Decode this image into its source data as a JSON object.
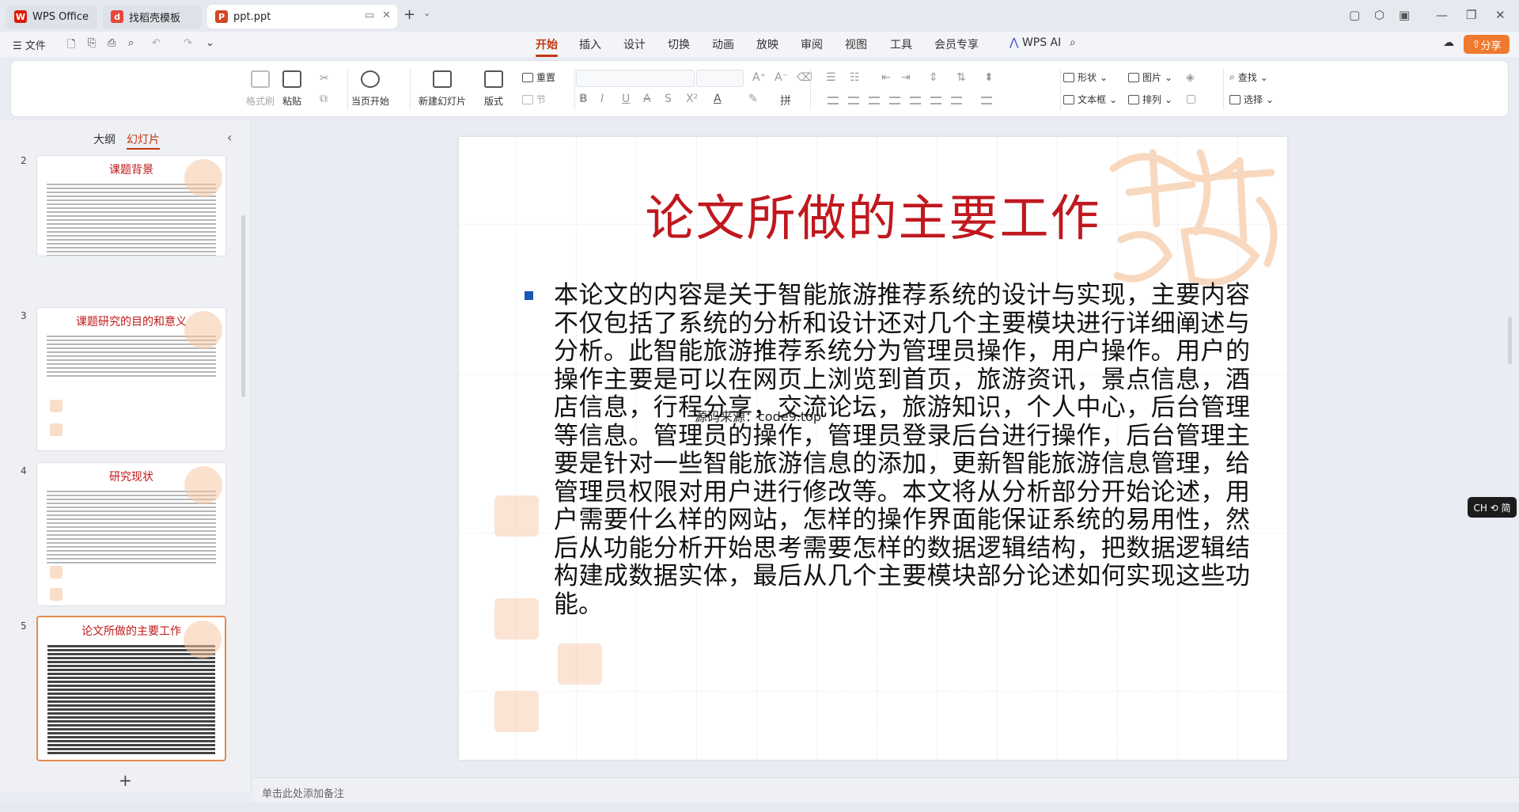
{
  "tabs": [
    {
      "label": "WPS Office",
      "icon": "wps-logo-icon",
      "color": "#d81e06"
    },
    {
      "label": "找稻壳模板",
      "icon": "docer-icon",
      "color": "#e5473a"
    },
    {
      "label": "ppt.ppt",
      "icon": "ppt-file-icon",
      "color": "#d24726"
    }
  ],
  "menubar": {
    "file_label": "文件",
    "ribbon_tabs": [
      "开始",
      "插入",
      "设计",
      "切换",
      "动画",
      "放映",
      "审阅",
      "视图",
      "工具",
      "会员专享"
    ],
    "active_tab": "开始",
    "wps_ai_label": "WPS AI",
    "share_label": "分享"
  },
  "ribbon": {
    "format_painter": "格式刷",
    "paste": "粘贴",
    "play_from_current": "当页开始",
    "new_slide": "新建幻灯片",
    "layout": "版式",
    "reset": "重置",
    "section": "节",
    "shape": "形状",
    "picture": "图片",
    "textbox": "文本框",
    "arrange": "排列",
    "find": "查找",
    "select": "选择"
  },
  "left_panel": {
    "tab_outline": "大纲",
    "tab_slides": "幻灯片",
    "thumbnails": [
      {
        "num": "2",
        "title": "课题背景"
      },
      {
        "num": "3",
        "title": "课题研究的目的和意义"
      },
      {
        "num": "4",
        "title": "研究现状"
      },
      {
        "num": "5",
        "title": "论文所做的主要工作"
      }
    ]
  },
  "slide": {
    "title": "论文所做的主要工作",
    "body": "本论文的内容是关于智能旅游推荐系统的设计与实现，主要内容不仅包括了系统的分析和设计还对几个主要模块进行详细阐述与分析。此智能旅游推荐系统分为管理员操作，用户操作。用户的操作主要是可以在网页上浏览到首页，旅游资讯，景点信息，酒店信息，行程分享，交流论坛，旅游知识，个人中心，后台管理等信息。管理员的操作，管理员登录后台进行操作，后台管理主要是针对一些智能旅游信息的添加，更新智能旅游信息管理，给管理员权限对用户进行修改等。本文将从分析部分开始论述，用户需要什么样的网站，怎样的操作界面能保证系统的易用性，然后从功能分析开始思考需要怎样的数据逻辑结构，把数据逻辑结构建成数据实体，最后从几个主要模块部分论述如何实现这些功能。",
    "watermark": "源码来源：code9.top"
  },
  "notes_placeholder": "单击此处添加备注",
  "ime_badge": "CH ⟲ 简",
  "colors": {
    "accent": "#c3370e",
    "title_red": "#c0181e",
    "bullet_blue": "#1a56b8"
  }
}
